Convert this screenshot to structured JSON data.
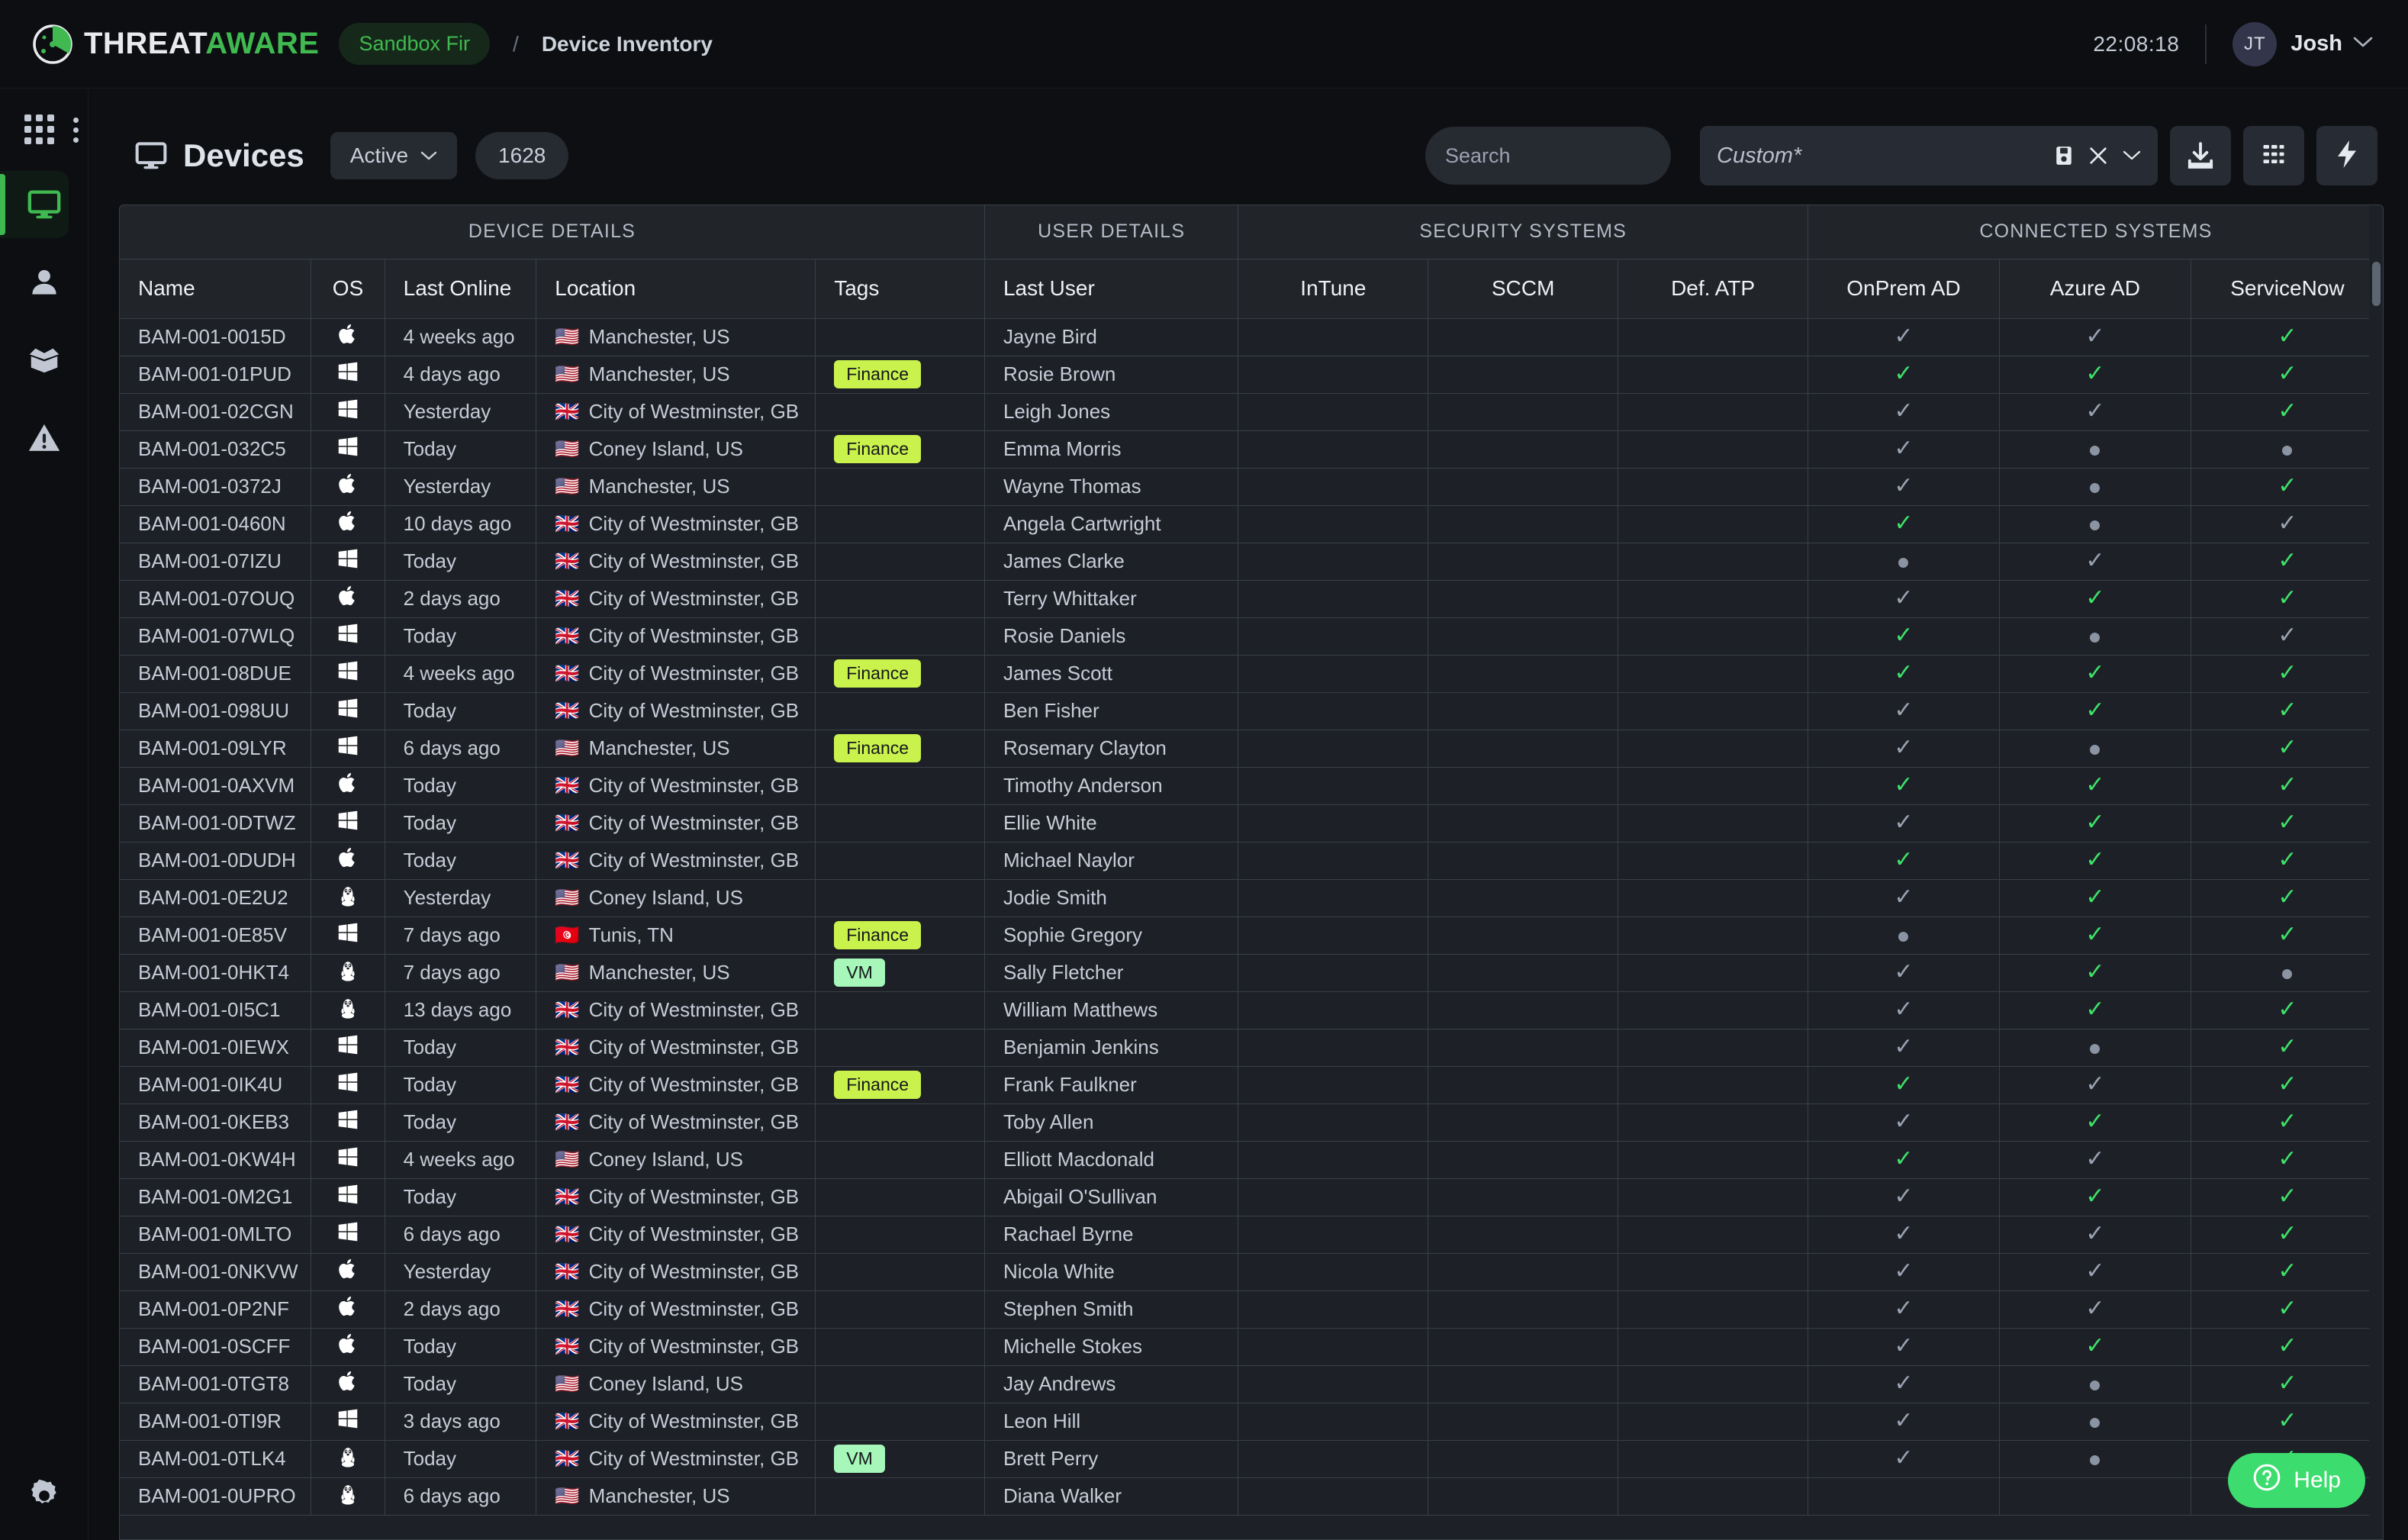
{
  "topbar": {
    "logo_primary": "THREAT",
    "logo_secondary": "AWARE",
    "tenant_badge": "Sandbox Fir",
    "separator": "/",
    "breadcrumb_current": "Device Inventory",
    "clock": "22:08:18",
    "avatar_initials": "JT",
    "username": "Josh"
  },
  "sidebar": {
    "items": [
      {
        "name": "apps-grid-icon",
        "label": "Apps"
      },
      {
        "name": "more-vertical-icon",
        "label": "More"
      },
      {
        "name": "devices-monitor-icon",
        "label": "Devices"
      },
      {
        "name": "users-person-icon",
        "label": "Users"
      },
      {
        "name": "assets-box-icon",
        "label": "Assets"
      },
      {
        "name": "alerts-warning-icon",
        "label": "Alerts"
      },
      {
        "name": "settings-gear-icon",
        "label": "Settings"
      }
    ]
  },
  "toolbar": {
    "page_title": "Devices",
    "status_filter": "Active",
    "device_count": "1628",
    "search_placeholder": "Search",
    "search_value": "",
    "saved_filter": "Custom*",
    "buttons": {
      "save_filter": "save-disk-icon",
      "clear_filter": "clear-x-icon",
      "filter_dropdown": "chevron-down-icon",
      "export": "download-icon",
      "columns": "columns-grid-icon",
      "actions": "lightning-bolt-icon"
    }
  },
  "table": {
    "group_headers": [
      {
        "label": "DEVICE DETAILS",
        "span": 5
      },
      {
        "label": "USER DETAILS",
        "span": 1
      },
      {
        "label": "SECURITY SYSTEMS",
        "span": 3
      },
      {
        "label": "CONNECTED SYSTEMS",
        "span": 3
      }
    ],
    "columns": [
      "Name",
      "OS",
      "Last Online",
      "Location",
      "Tags",
      "Last User",
      "InTune",
      "SCCM",
      "Def. ATP",
      "OnPrem AD",
      "Azure AD",
      "ServiceNow"
    ],
    "rows": [
      {
        "name": "BAM-001-0015D",
        "os": "apple",
        "last_online": "4 weeks ago",
        "flag": "🇺🇸",
        "location": "Manchester, US",
        "tag": "",
        "last_user": "Jayne Bird",
        "intune": "",
        "sccm": "",
        "defatp": "",
        "onprem": "check-gray",
        "azure": "check-gray",
        "servicenow": "check-green"
      },
      {
        "name": "BAM-001-01PUD",
        "os": "windows",
        "last_online": "4 days ago",
        "flag": "🇺🇸",
        "location": "Manchester, US",
        "tag": "Finance",
        "last_user": "Rosie Brown",
        "intune": "",
        "sccm": "",
        "defatp": "",
        "onprem": "check-green",
        "azure": "check-green",
        "servicenow": "check-green"
      },
      {
        "name": "BAM-001-02CGN",
        "os": "windows",
        "last_online": "Yesterday",
        "flag": "🇬🇧",
        "location": "City of Westminster, GB",
        "tag": "",
        "last_user": "Leigh Jones",
        "intune": "",
        "sccm": "",
        "defatp": "",
        "onprem": "check-gray",
        "azure": "check-gray",
        "servicenow": "check-green"
      },
      {
        "name": "BAM-001-032C5",
        "os": "windows",
        "last_online": "Today",
        "flag": "🇺🇸",
        "location": "Coney Island, US",
        "tag": "Finance",
        "last_user": "Emma Morris",
        "intune": "",
        "sccm": "",
        "defatp": "",
        "onprem": "check-gray",
        "azure": "dot",
        "servicenow": "dot"
      },
      {
        "name": "BAM-001-0372J",
        "os": "apple",
        "last_online": "Yesterday",
        "flag": "🇺🇸",
        "location": "Manchester, US",
        "tag": "",
        "last_user": "Wayne Thomas",
        "intune": "",
        "sccm": "",
        "defatp": "",
        "onprem": "check-gray",
        "azure": "dot",
        "servicenow": "check-green"
      },
      {
        "name": "BAM-001-0460N",
        "os": "apple",
        "last_online": "10 days ago",
        "flag": "🇬🇧",
        "location": "City of Westminster, GB",
        "tag": "",
        "last_user": "Angela Cartwright",
        "intune": "",
        "sccm": "",
        "defatp": "",
        "onprem": "check-green",
        "azure": "dot",
        "servicenow": "check-gray"
      },
      {
        "name": "BAM-001-07IZU",
        "os": "windows",
        "last_online": "Today",
        "flag": "🇬🇧",
        "location": "City of Westminster, GB",
        "tag": "",
        "last_user": "James Clarke",
        "intune": "",
        "sccm": "",
        "defatp": "",
        "onprem": "dot",
        "azure": "check-gray",
        "servicenow": "check-green"
      },
      {
        "name": "BAM-001-07OUQ",
        "os": "apple",
        "last_online": "2 days ago",
        "flag": "🇬🇧",
        "location": "City of Westminster, GB",
        "tag": "",
        "last_user": "Terry Whittaker",
        "intune": "",
        "sccm": "",
        "defatp": "",
        "onprem": "check-gray",
        "azure": "check-green",
        "servicenow": "check-green"
      },
      {
        "name": "BAM-001-07WLQ",
        "os": "windows",
        "last_online": "Today",
        "flag": "🇬🇧",
        "location": "City of Westminster, GB",
        "tag": "",
        "last_user": "Rosie Daniels",
        "intune": "",
        "sccm": "",
        "defatp": "",
        "onprem": "check-green",
        "azure": "dot",
        "servicenow": "check-gray"
      },
      {
        "name": "BAM-001-08DUE",
        "os": "windows",
        "last_online": "4 weeks ago",
        "flag": "🇬🇧",
        "location": "City of Westminster, GB",
        "tag": "Finance",
        "last_user": "James Scott",
        "intune": "",
        "sccm": "",
        "defatp": "",
        "onprem": "check-green",
        "azure": "check-green",
        "servicenow": "check-green"
      },
      {
        "name": "BAM-001-098UU",
        "os": "windows",
        "last_online": "Today",
        "flag": "🇬🇧",
        "location": "City of Westminster, GB",
        "tag": "",
        "last_user": "Ben Fisher",
        "intune": "",
        "sccm": "",
        "defatp": "",
        "onprem": "check-gray",
        "azure": "check-green",
        "servicenow": "check-green"
      },
      {
        "name": "BAM-001-09LYR",
        "os": "windows",
        "last_online": "6 days ago",
        "flag": "🇺🇸",
        "location": "Manchester, US",
        "tag": "Finance",
        "last_user": "Rosemary Clayton",
        "intune": "",
        "sccm": "",
        "defatp": "",
        "onprem": "check-gray",
        "azure": "dot",
        "servicenow": "check-green"
      },
      {
        "name": "BAM-001-0AXVM",
        "os": "apple",
        "last_online": "Today",
        "flag": "🇬🇧",
        "location": "City of Westminster, GB",
        "tag": "",
        "last_user": "Timothy Anderson",
        "intune": "",
        "sccm": "",
        "defatp": "",
        "onprem": "check-green",
        "azure": "check-green",
        "servicenow": "check-green"
      },
      {
        "name": "BAM-001-0DTWZ",
        "os": "windows",
        "last_online": "Today",
        "flag": "🇬🇧",
        "location": "City of Westminster, GB",
        "tag": "",
        "last_user": "Ellie White",
        "intune": "",
        "sccm": "",
        "defatp": "",
        "onprem": "check-gray",
        "azure": "check-green",
        "servicenow": "check-green"
      },
      {
        "name": "BAM-001-0DUDH",
        "os": "apple",
        "last_online": "Today",
        "flag": "🇬🇧",
        "location": "City of Westminster, GB",
        "tag": "",
        "last_user": "Michael Naylor",
        "intune": "",
        "sccm": "",
        "defatp": "",
        "onprem": "check-green",
        "azure": "check-green",
        "servicenow": "check-green"
      },
      {
        "name": "BAM-001-0E2U2",
        "os": "linux",
        "last_online": "Yesterday",
        "flag": "🇺🇸",
        "location": "Coney Island, US",
        "tag": "",
        "last_user": "Jodie Smith",
        "intune": "",
        "sccm": "",
        "defatp": "",
        "onprem": "check-gray",
        "azure": "check-green",
        "servicenow": "check-green"
      },
      {
        "name": "BAM-001-0E85V",
        "os": "windows",
        "last_online": "7 days ago",
        "flag": "🇹🇳",
        "location": "Tunis, TN",
        "tag": "Finance",
        "last_user": "Sophie Gregory",
        "intune": "",
        "sccm": "",
        "defatp": "",
        "onprem": "dot",
        "azure": "check-green",
        "servicenow": "check-green"
      },
      {
        "name": "BAM-001-0HKT4",
        "os": "linux",
        "last_online": "7 days ago",
        "flag": "🇺🇸",
        "location": "Manchester, US",
        "tag": "VM",
        "last_user": "Sally Fletcher",
        "intune": "",
        "sccm": "",
        "defatp": "",
        "onprem": "check-gray",
        "azure": "check-green",
        "servicenow": "dot"
      },
      {
        "name": "BAM-001-0I5C1",
        "os": "linux",
        "last_online": "13 days ago",
        "flag": "🇬🇧",
        "location": "City of Westminster, GB",
        "tag": "",
        "last_user": "William Matthews",
        "intune": "",
        "sccm": "",
        "defatp": "",
        "onprem": "check-gray",
        "azure": "check-green",
        "servicenow": "check-green"
      },
      {
        "name": "BAM-001-0IEWX",
        "os": "windows",
        "last_online": "Today",
        "flag": "🇬🇧",
        "location": "City of Westminster, GB",
        "tag": "",
        "last_user": "Benjamin Jenkins",
        "intune": "",
        "sccm": "",
        "defatp": "",
        "onprem": "check-gray",
        "azure": "dot",
        "servicenow": "check-green"
      },
      {
        "name": "BAM-001-0IK4U",
        "os": "windows",
        "last_online": "Today",
        "flag": "🇬🇧",
        "location": "City of Westminster, GB",
        "tag": "Finance",
        "last_user": "Frank Faulkner",
        "intune": "",
        "sccm": "",
        "defatp": "",
        "onprem": "check-green",
        "azure": "check-gray",
        "servicenow": "check-green"
      },
      {
        "name": "BAM-001-0KEB3",
        "os": "windows",
        "last_online": "Today",
        "flag": "🇬🇧",
        "location": "City of Westminster, GB",
        "tag": "",
        "last_user": "Toby Allen",
        "intune": "",
        "sccm": "",
        "defatp": "",
        "onprem": "check-gray",
        "azure": "check-green",
        "servicenow": "check-green"
      },
      {
        "name": "BAM-001-0KW4H",
        "os": "windows",
        "last_online": "4 weeks ago",
        "flag": "🇺🇸",
        "location": "Coney Island, US",
        "tag": "",
        "last_user": "Elliott Macdonald",
        "intune": "",
        "sccm": "",
        "defatp": "",
        "onprem": "check-green",
        "azure": "check-gray",
        "servicenow": "check-green"
      },
      {
        "name": "BAM-001-0M2G1",
        "os": "windows",
        "last_online": "Today",
        "flag": "🇬🇧",
        "location": "City of Westminster, GB",
        "tag": "",
        "last_user": "Abigail O'Sullivan",
        "intune": "",
        "sccm": "",
        "defatp": "",
        "onprem": "check-gray",
        "azure": "check-green",
        "servicenow": "check-green"
      },
      {
        "name": "BAM-001-0MLTO",
        "os": "windows",
        "last_online": "6 days ago",
        "flag": "🇬🇧",
        "location": "City of Westminster, GB",
        "tag": "",
        "last_user": "Rachael Byrne",
        "intune": "",
        "sccm": "",
        "defatp": "",
        "onprem": "check-gray",
        "azure": "check-gray",
        "servicenow": "check-green"
      },
      {
        "name": "BAM-001-0NKVW",
        "os": "apple",
        "last_online": "Yesterday",
        "flag": "🇬🇧",
        "location": "City of Westminster, GB",
        "tag": "",
        "last_user": "Nicola White",
        "intune": "",
        "sccm": "",
        "defatp": "",
        "onprem": "check-gray",
        "azure": "check-gray",
        "servicenow": "check-green"
      },
      {
        "name": "BAM-001-0P2NF",
        "os": "apple",
        "last_online": "2 days ago",
        "flag": "🇬🇧",
        "location": "City of Westminster, GB",
        "tag": "",
        "last_user": "Stephen Smith",
        "intune": "",
        "sccm": "",
        "defatp": "",
        "onprem": "check-gray",
        "azure": "check-gray",
        "servicenow": "check-green"
      },
      {
        "name": "BAM-001-0SCFF",
        "os": "apple",
        "last_online": "Today",
        "flag": "🇬🇧",
        "location": "City of Westminster, GB",
        "tag": "",
        "last_user": "Michelle Stokes",
        "intune": "",
        "sccm": "",
        "defatp": "",
        "onprem": "check-gray",
        "azure": "check-green",
        "servicenow": "check-green"
      },
      {
        "name": "BAM-001-0TGT8",
        "os": "apple",
        "last_online": "Today",
        "flag": "🇺🇸",
        "location": "Coney Island, US",
        "tag": "",
        "last_user": "Jay Andrews",
        "intune": "",
        "sccm": "",
        "defatp": "",
        "onprem": "check-gray",
        "azure": "dot",
        "servicenow": "check-green"
      },
      {
        "name": "BAM-001-0TI9R",
        "os": "windows",
        "last_online": "3 days ago",
        "flag": "🇬🇧",
        "location": "City of Westminster, GB",
        "tag": "",
        "last_user": "Leon Hill",
        "intune": "",
        "sccm": "",
        "defatp": "",
        "onprem": "check-gray",
        "azure": "dot",
        "servicenow": "check-green"
      },
      {
        "name": "BAM-001-0TLK4",
        "os": "linux",
        "last_online": "Today",
        "flag": "🇬🇧",
        "location": "City of Westminster, GB",
        "tag": "VM",
        "last_user": "Brett Perry",
        "intune": "",
        "sccm": "",
        "defatp": "",
        "onprem": "check-gray",
        "azure": "dot",
        "servicenow": "check-green"
      },
      {
        "name": "BAM-001-0UPRO",
        "os": "linux",
        "last_online": "6 days ago",
        "flag": "🇺🇸",
        "location": "Manchester, US",
        "tag": "",
        "last_user": "Diana Walker",
        "intune": "",
        "sccm": "",
        "defatp": "",
        "onprem": "",
        "azure": "",
        "servicenow": ""
      }
    ]
  },
  "help": {
    "label": "Help"
  },
  "colors": {
    "brand_green": "#3fb950",
    "check_green": "#3ee16a",
    "check_gray": "#9aa2b1",
    "tag_finance": "#c9f24d",
    "tag_vm": "#a6f7b9",
    "help_green": "#3ddc6e"
  }
}
